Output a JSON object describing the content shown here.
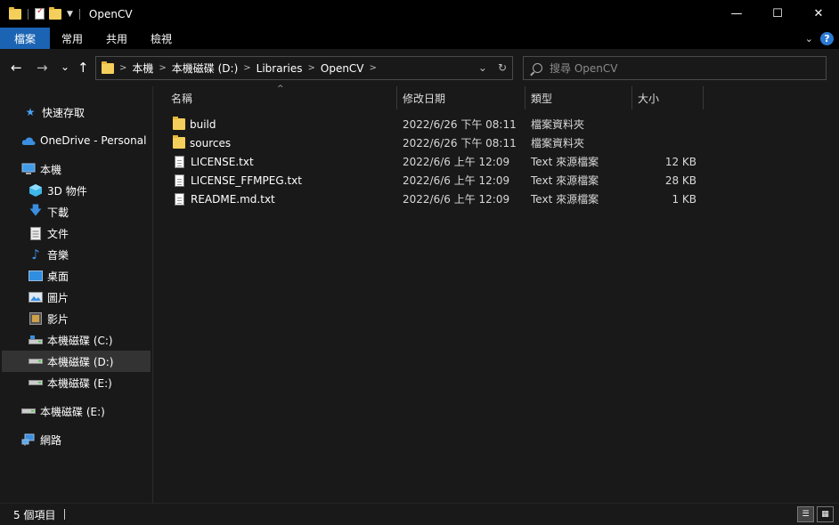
{
  "window": {
    "title": "OpenCV",
    "controls": {
      "minimize": "—",
      "maximize": "☐",
      "close": "✕"
    }
  },
  "ribbon": {
    "tabs": [
      {
        "label": "檔案",
        "active": true
      },
      {
        "label": "常用",
        "active": false
      },
      {
        "label": "共用",
        "active": false
      },
      {
        "label": "檢視",
        "active": false
      }
    ],
    "help": "?"
  },
  "navigation": {
    "back": "←",
    "forward": "→",
    "recent": "⌄",
    "up": "↑",
    "breadcrumbs": [
      "本機",
      "本機磁碟 (D:)",
      "Libraries",
      "OpenCV"
    ],
    "search_placeholder": "搜尋 OpenCV"
  },
  "sidebar": {
    "items": [
      {
        "label": "快速存取",
        "icon": "star-icon",
        "selected": false
      },
      {
        "label": "OneDrive - Personal",
        "icon": "cloud-icon",
        "selected": false
      },
      {
        "label": "本機",
        "icon": "computer-icon",
        "selected": false
      },
      {
        "label": "3D 物件",
        "icon": "cube-icon",
        "selected": false
      },
      {
        "label": "下載",
        "icon": "download-icon",
        "selected": false
      },
      {
        "label": "文件",
        "icon": "document-icon",
        "selected": false
      },
      {
        "label": "音樂",
        "icon": "music-icon",
        "selected": false
      },
      {
        "label": "桌面",
        "icon": "desktop-icon",
        "selected": false
      },
      {
        "label": "圖片",
        "icon": "picture-icon",
        "selected": false
      },
      {
        "label": "影片",
        "icon": "video-icon",
        "selected": false
      },
      {
        "label": "本機磁碟 (C:)",
        "icon": "drive-icon",
        "selected": false
      },
      {
        "label": "本機磁碟 (D:)",
        "icon": "drive-icon",
        "selected": true
      },
      {
        "label": "本機磁碟 (E:)",
        "icon": "drive-icon",
        "selected": false
      },
      {
        "label": "本機磁碟 (E:)",
        "icon": "drive-icon",
        "selected": false
      },
      {
        "label": "網路",
        "icon": "network-icon",
        "selected": false
      }
    ]
  },
  "columns": {
    "name": "名稱",
    "date": "修改日期",
    "type": "類型",
    "size": "大小"
  },
  "files": [
    {
      "name": "build",
      "date": "2022/6/26 下午 08:11",
      "type": "檔案資料夾",
      "size": "",
      "kind": "folder"
    },
    {
      "name": "sources",
      "date": "2022/6/26 下午 08:11",
      "type": "檔案資料夾",
      "size": "",
      "kind": "folder"
    },
    {
      "name": "LICENSE.txt",
      "date": "2022/6/6 上午 12:09",
      "type": "Text 來源檔案",
      "size": "12 KB",
      "kind": "text"
    },
    {
      "name": "LICENSE_FFMPEG.txt",
      "date": "2022/6/6 上午 12:09",
      "type": "Text 來源檔案",
      "size": "28 KB",
      "kind": "text"
    },
    {
      "name": "README.md.txt",
      "date": "2022/6/6 上午 12:09",
      "type": "Text 來源檔案",
      "size": "1 KB",
      "kind": "text"
    }
  ],
  "status": {
    "count": "5 個項目"
  },
  "colors": {
    "accent": "#1b64b4",
    "folder": "#f5cf5b",
    "selected_bg": "#333333"
  }
}
